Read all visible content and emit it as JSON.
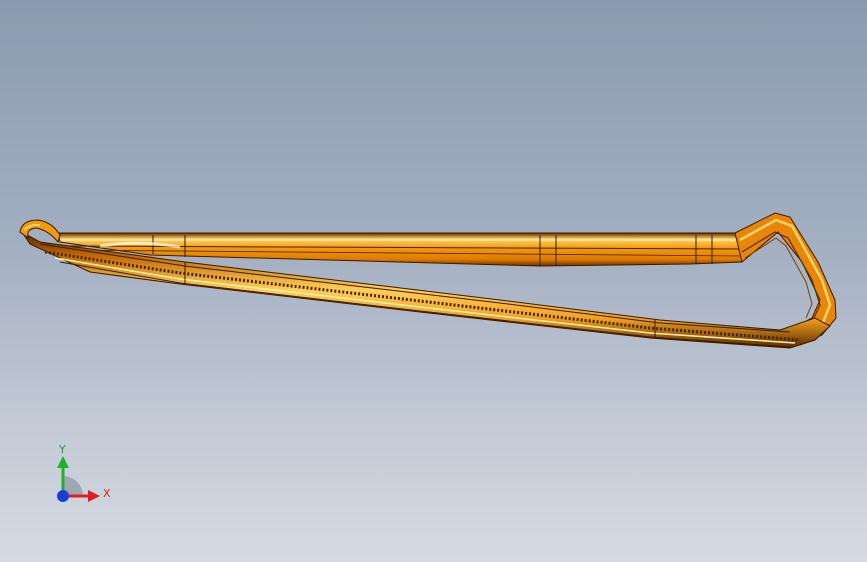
{
  "viewport": {
    "background_top": "#8a9bb1",
    "background_bottom": "#d6dae2",
    "model": {
      "name": "bent-frame-part",
      "color": "#f29a0c",
      "highlight_color": "#ffd36b",
      "shadow_color": "#7a3f00"
    }
  },
  "triad": {
    "x_label": "X",
    "y_label": "Y",
    "x_color": "#e02020",
    "y_color": "#20b030",
    "z_color": "#1a3fd6"
  }
}
